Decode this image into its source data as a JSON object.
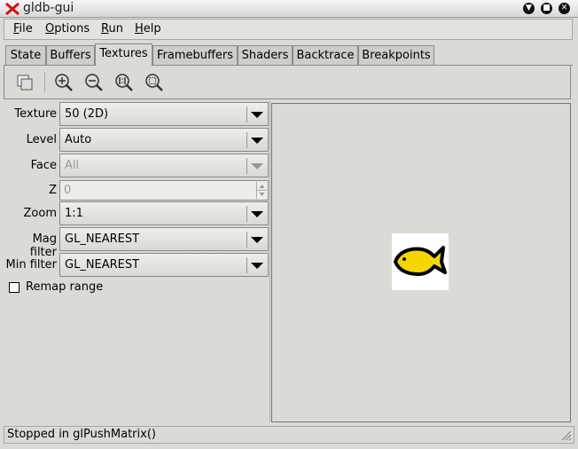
{
  "window": {
    "title": "gldb-gui"
  },
  "menu": [
    "File",
    "Options",
    "Run",
    "Help"
  ],
  "tabs": [
    "State",
    "Buffers",
    "Textures",
    "Framebuffers",
    "Shaders",
    "Backtrace",
    "Breakpoints"
  ],
  "active_tab": "Textures",
  "toolbar": {
    "icons": [
      "copy-icon",
      "zoom-in-icon",
      "zoom-out-icon",
      "zoom-1to1-icon",
      "zoom-fit-icon"
    ]
  },
  "controls": {
    "texture": {
      "label": "Texture",
      "value": "50 (2D)"
    },
    "level": {
      "label": "Level",
      "value": "Auto"
    },
    "face": {
      "label": "Face",
      "value": "All",
      "enabled": false
    },
    "z": {
      "label": "Z",
      "value": "0",
      "enabled": false
    },
    "zoom": {
      "label": "Zoom",
      "value": "1:1"
    },
    "mag_filter": {
      "label": "Mag filter",
      "value": "GL_NEAREST"
    },
    "min_filter": {
      "label": "Min filter",
      "value": "GL_NEAREST"
    },
    "remap": {
      "label": "Remap range",
      "checked": false
    }
  },
  "status": {
    "text": "Stopped in glPushMatrix()"
  },
  "colors": {
    "fish_fill": "#f5d600",
    "fish_outline": "#000000"
  }
}
